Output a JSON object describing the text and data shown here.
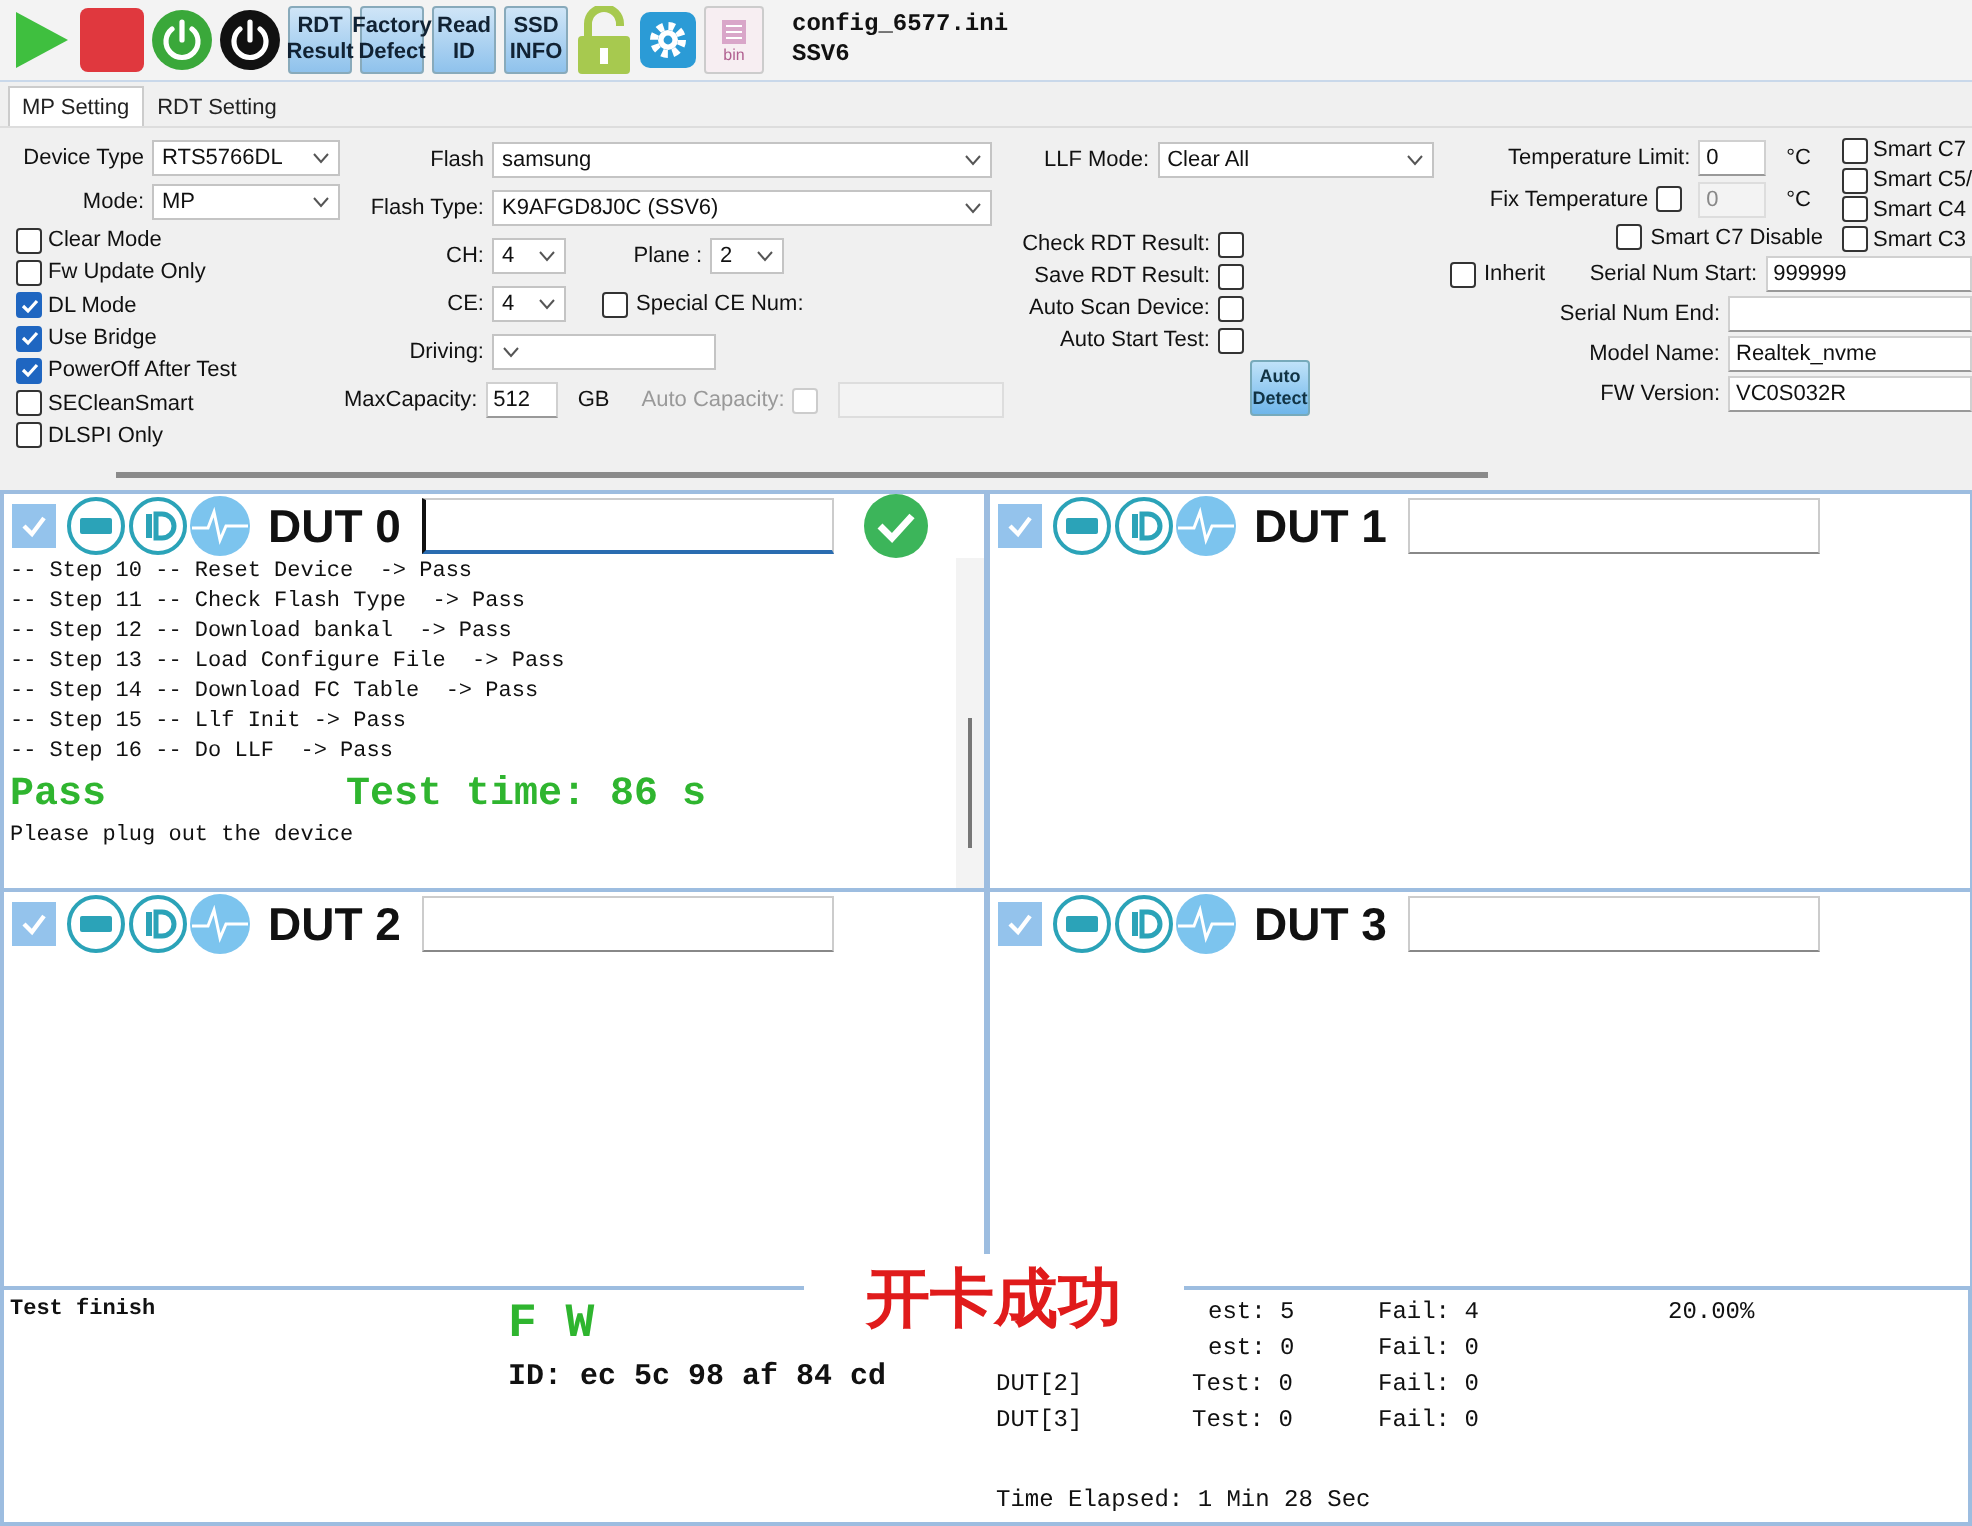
{
  "toolbar": {
    "buttons": [
      {
        "kind": "play"
      },
      {
        "kind": "stop"
      },
      {
        "kind": "power-green"
      },
      {
        "kind": "power-black"
      },
      {
        "kind": "text",
        "lines": [
          "RDT",
          "Result"
        ]
      },
      {
        "kind": "text",
        "lines": [
          "Factory",
          "Defect"
        ]
      },
      {
        "kind": "text",
        "lines": [
          "Read",
          "ID"
        ]
      },
      {
        "kind": "text",
        "lines": [
          "SSD",
          "INFO"
        ]
      },
      {
        "kind": "lock"
      },
      {
        "kind": "gear"
      },
      {
        "kind": "bin",
        "caption": "bin"
      }
    ],
    "config": [
      "config_6577.ini",
      "SSV6"
    ]
  },
  "tabs": [
    {
      "label": "MP Setting",
      "selected": true
    },
    {
      "label": "RDT Setting",
      "selected": false
    }
  ],
  "settings": {
    "device_type": {
      "label": "Device Type",
      "value": "RTS5766DL"
    },
    "mode": {
      "label": "Mode:",
      "value": "MP"
    },
    "options": [
      {
        "label": "Clear Mode",
        "checked": false
      },
      {
        "label": "Fw Update Only",
        "checked": false
      },
      {
        "label": "DL Mode",
        "checked": true
      },
      {
        "label": "Use Bridge",
        "checked": true
      },
      {
        "label": "PowerOff After Test",
        "checked": true
      },
      {
        "label": "SECleanSmart",
        "checked": false
      },
      {
        "label": "DLSPI Only",
        "checked": false
      }
    ],
    "flash": {
      "label": "Flash",
      "value": "samsung"
    },
    "flash_type": {
      "label": "Flash Type:",
      "value": "K9AFGD8J0C (SSV6)"
    },
    "ch": {
      "label": "CH:",
      "value": "4"
    },
    "plane": {
      "label": "Plane :",
      "value": "2"
    },
    "ce": {
      "label": "CE:",
      "value": "4"
    },
    "special_ce": {
      "label": "Special CE Num:",
      "checked": false
    },
    "driving": {
      "label": "Driving:"
    },
    "max_capacity": {
      "label": "MaxCapacity:",
      "value": "512",
      "unit": "GB"
    },
    "auto_capacity": {
      "label": "Auto Capacity:",
      "checked": false
    },
    "llf_mode": {
      "label": "LLF Mode:",
      "value": "Clear All"
    },
    "rdt_options": [
      {
        "label": "Check RDT Result:",
        "checked": false
      },
      {
        "label": "Save RDT Result:",
        "checked": false
      },
      {
        "label": "Auto Scan Device:",
        "checked": false
      },
      {
        "label": "Auto Start Test:",
        "checked": false
      }
    ],
    "auto_detect": [
      "Auto",
      "Detect"
    ],
    "temperature_limit": {
      "label": "Temperature Limit:",
      "value": "0",
      "unit": "°C"
    },
    "fix_temperature": {
      "label": "Fix Temperature",
      "checked": false,
      "value": "0",
      "unit": "°C"
    },
    "smart_c7_disable": {
      "label": "Smart C7 Disable",
      "checked": false
    },
    "smart_options": [
      {
        "label": "Smart C7",
        "checked": false
      },
      {
        "label": "Smart C5/",
        "checked": false
      },
      {
        "label": "Smart C4",
        "checked": false
      },
      {
        "label": "Smart C3",
        "checked": false
      }
    ],
    "inherit": {
      "label": "Inherit",
      "checked": false
    },
    "serial_start": {
      "label": "Serial Num Start:",
      "value": "999999"
    },
    "serial_end": {
      "label": "Serial Num End:"
    },
    "model_name": {
      "label": "Model Name:",
      "value": "Realtek_nvme"
    },
    "fw_version": {
      "label": "FW Version:",
      "value": "VC0S032R"
    }
  },
  "duts": [
    {
      "name": "DUT 0",
      "enabled": true,
      "passed": true,
      "log": [
        "-- Step 10 -- Reset Device  -> Pass",
        "-- Step 11 -- Check Flash Type  -> Pass",
        "-- Step 12 -- Download bankal  -> Pass",
        "-- Step 13 -- Load Configure File  -> Pass",
        "-- Step 14 -- Download FC Table  -> Pass",
        "-- Step 15 -- Llf Init -> Pass",
        "-- Step 16 -- Do LLF  -> Pass"
      ],
      "result": "Pass",
      "test_time": "Test time: 86 s",
      "message": "Please plug out the device"
    },
    {
      "name": "DUT 1",
      "enabled": true,
      "passed": false
    },
    {
      "name": "DUT 2",
      "enabled": true,
      "passed": false
    },
    {
      "name": "DUT 3",
      "enabled": true,
      "passed": false
    }
  ],
  "summary": {
    "status": "Test finish",
    "fw": "F W",
    "id": "ID: ec 5c 98 af 84 cd",
    "rows": [
      {
        "test": "est: 5",
        "fail": "Fail: 4",
        "rate": "20.00%"
      },
      {
        "test": "est: 0",
        "fail": "Fail: 0"
      },
      {
        "dut": "DUT[2]",
        "test": "Test: 0",
        "fail": "Fail: 0"
      },
      {
        "dut": "DUT[3]",
        "test": "Test: 0",
        "fail": "Fail: 0"
      }
    ],
    "elapsed": "Time Elapsed: 1 Min 28 Sec"
  },
  "overlay": "开卡成功"
}
